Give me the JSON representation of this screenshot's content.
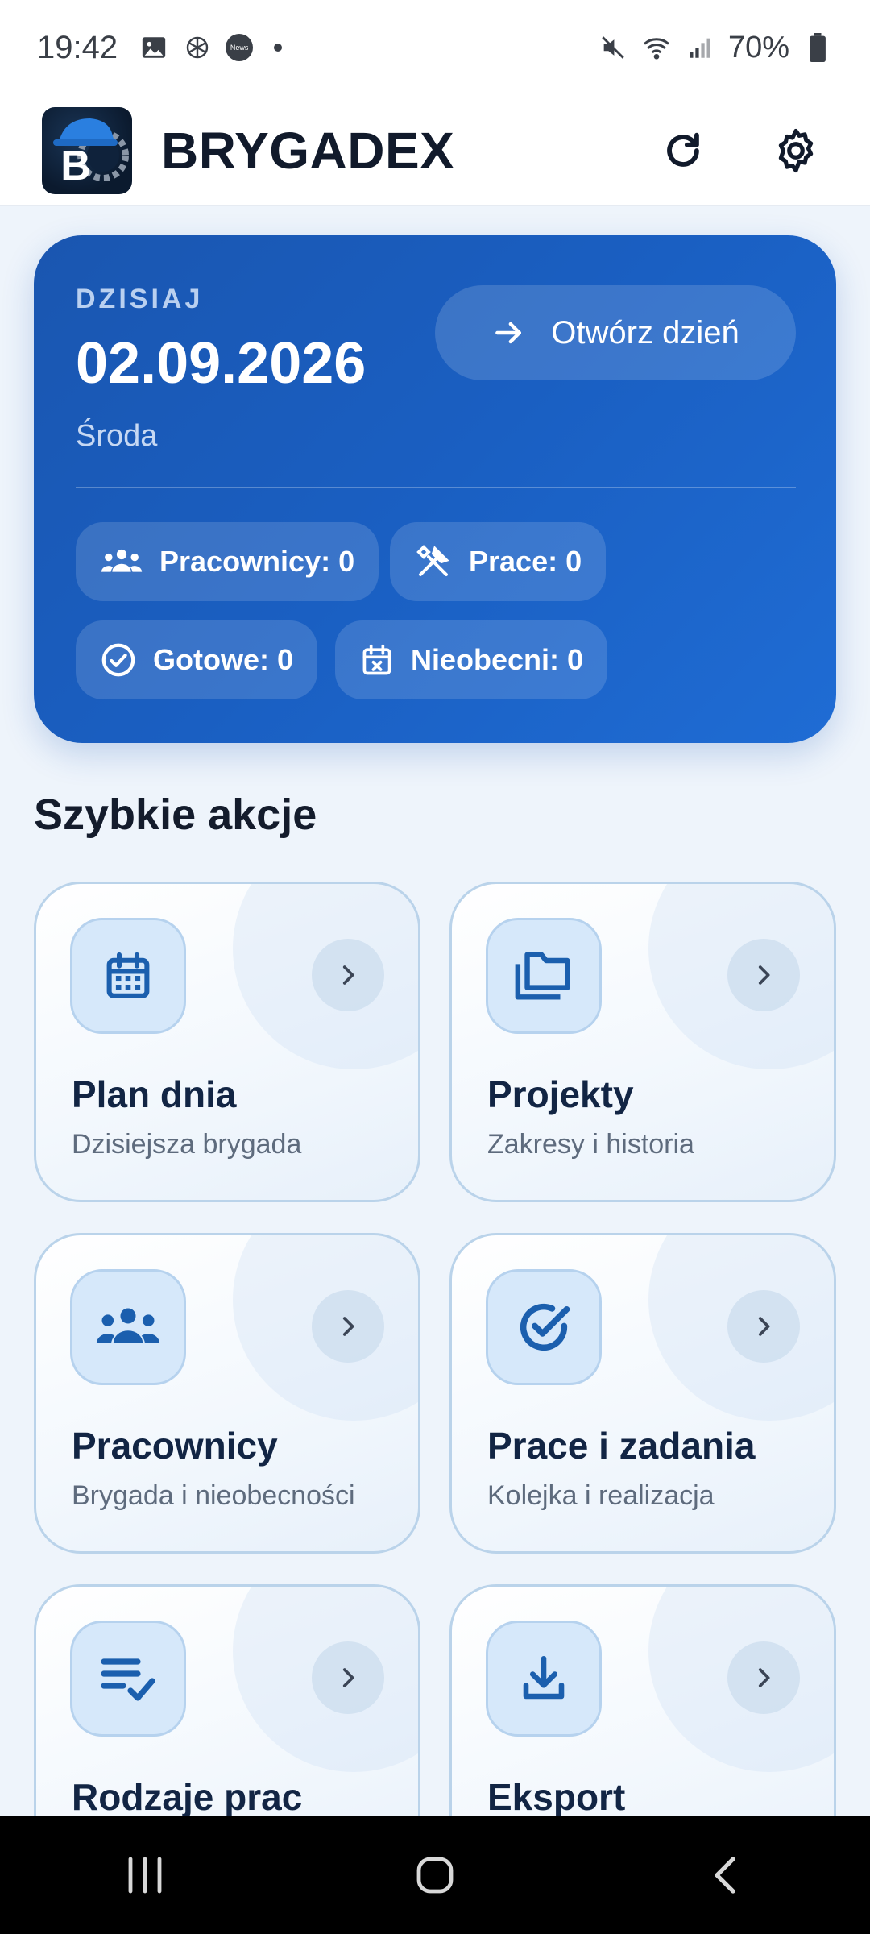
{
  "status_bar": {
    "time": "19:42",
    "news_badge": "News",
    "battery": "70%",
    "icons": [
      "gallery-icon",
      "openai-icon",
      "news-icon",
      "mute-icon",
      "wifi-icon",
      "signal-icon",
      "battery-icon"
    ]
  },
  "app_bar": {
    "logo_letter": "B",
    "title": "BRYGADEX",
    "actions": [
      "refresh-icon",
      "settings-icon"
    ]
  },
  "today": {
    "label": "DZISIAJ",
    "date": "02.09.2026",
    "weekday": "Środa",
    "open_button": "Otwórz dzień",
    "stats": [
      {
        "label": "Pracownicy: 0",
        "icon": "people-icon"
      },
      {
        "label": "Prace: 0",
        "icon": "tools-icon"
      },
      {
        "label": "Gotowe: 0",
        "icon": "check-circle-icon"
      },
      {
        "label": "Nieobecni: 0",
        "icon": "calendar-x-icon"
      }
    ]
  },
  "quick_actions": {
    "title": "Szybkie akcje",
    "tiles": [
      {
        "title": "Plan dnia",
        "subtitle": "Dzisiejsza brygada",
        "icon": "calendar-icon"
      },
      {
        "title": "Projekty",
        "subtitle": "Zakresy i historia",
        "icon": "folders-icon"
      },
      {
        "title": "Pracownicy",
        "subtitle": "Brygada i nieobecności",
        "icon": "people-icon"
      },
      {
        "title": "Prace i zadania",
        "subtitle": "Kolejka i realizacja",
        "icon": "check-circle-icon"
      },
      {
        "title": "Rodzaje prac",
        "subtitle": "",
        "icon": "list-check-icon"
      },
      {
        "title": "Eksport",
        "subtitle": "",
        "icon": "download-icon"
      }
    ]
  },
  "colors": {
    "accent": "#1a5fc2",
    "icon_blue": "#1b5fae",
    "tile_border": "#bad3ea",
    "background": "#eef4fb"
  }
}
